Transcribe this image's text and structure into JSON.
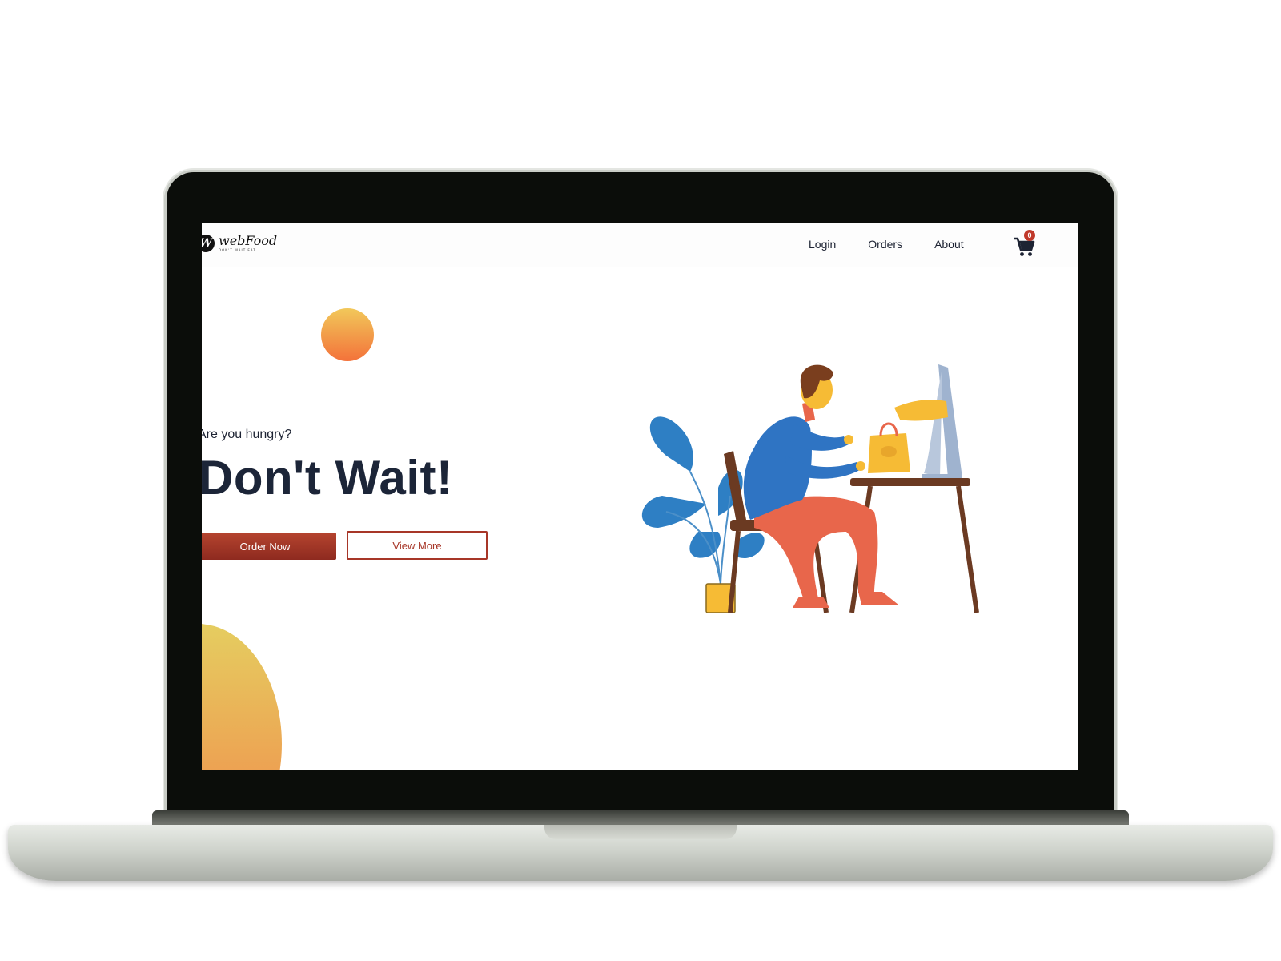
{
  "site": {
    "logo": {
      "mark": "W",
      "name": "webFood",
      "tagline": "DON'T WAIT EAT"
    },
    "nav": {
      "links": [
        "Login",
        "Orders",
        "About"
      ]
    },
    "cart": {
      "icon": "cart-icon",
      "count": "0"
    },
    "hero": {
      "subtitle": "Are you hungry?",
      "title": "Don't Wait!",
      "order_label": "Order Now",
      "view_label": "View More"
    },
    "colors": {
      "accent": "#9a3222",
      "title": "#1c2538",
      "sun_top": "#f2c85a",
      "sun_bottom": "#f3723a"
    }
  }
}
